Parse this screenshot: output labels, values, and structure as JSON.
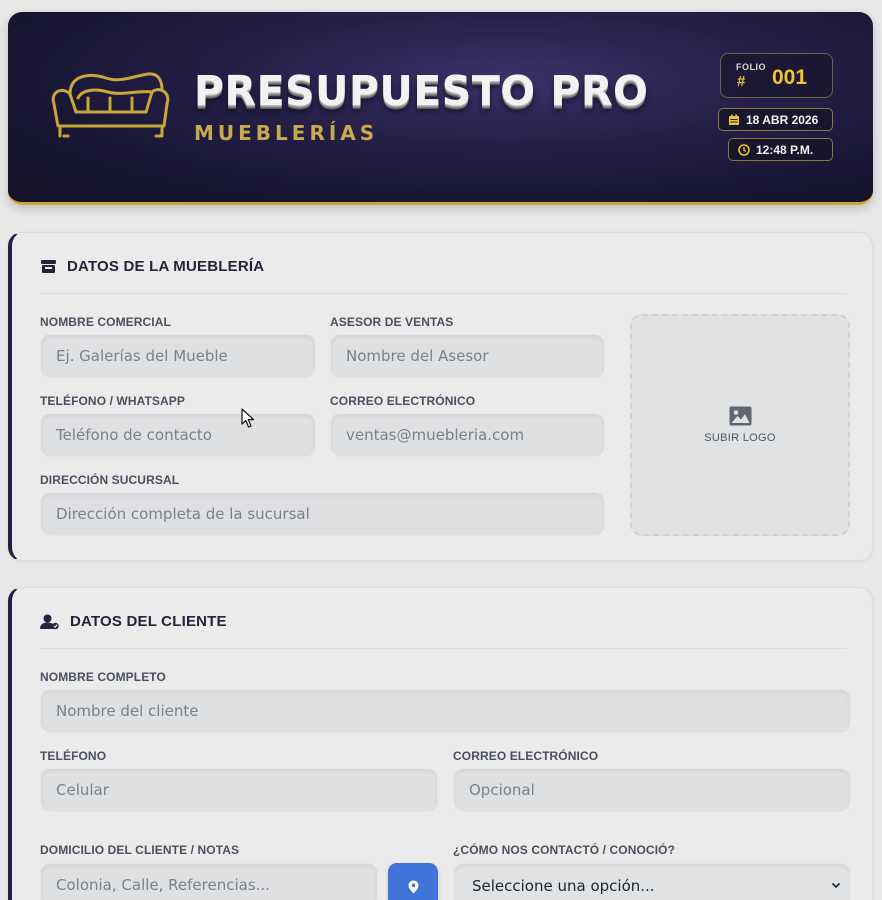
{
  "header": {
    "title": "PRESUPUESTO PRO",
    "subtitle": "MUEBLERÍAS",
    "folio_label": "FOLIO",
    "folio_hash": "#",
    "folio_number": "001",
    "date": "18 ABR 2026",
    "time": "12:48 P.M."
  },
  "store": {
    "section_title": "DATOS DE LA MUEBLERÍA",
    "trade_name_label": "NOMBRE COMERCIAL",
    "trade_name_placeholder": "Ej. Galerías del Mueble",
    "advisor_label": "ASESOR DE VENTAS",
    "advisor_placeholder": "Nombre del Asesor",
    "phone_label": "TELÉFONO / WHATSAPP",
    "phone_placeholder": "Teléfono de contacto",
    "email_label": "CORREO ELECTRÓNICO",
    "email_placeholder": "ventas@muebleria.com",
    "address_label": "DIRECCIÓN SUCURSAL",
    "address_placeholder": "Dirección completa de la sucursal",
    "upload_logo_label": "SUBIR LOGO"
  },
  "client": {
    "section_title": "DATOS DEL CLIENTE",
    "full_name_label": "NOMBRE COMPLETO",
    "full_name_placeholder": "Nombre del cliente",
    "phone_label": "TELÉFONO",
    "phone_placeholder": "Celular",
    "email_label": "CORREO ELECTRÓNICO",
    "email_placeholder": "Opcional",
    "address_label": "DOMICILIO DEL CLIENTE / NOTAS",
    "address_placeholder": "Colonia, Calle, Referencias...",
    "contact_source_label": "¿CÓMO NOS CONTACTÓ / CONOCIÓ?",
    "contact_source_selected": "Seleccione una opción..."
  },
  "colors": {
    "header_bg": "#1c1937",
    "accent_gold": "#c8aa4e",
    "folio_yellow": "#f1c52c",
    "map_button_blue": "#3f73d8",
    "card_border_navy": "#22223f"
  },
  "icons": {
    "header_logo": "sofa-icon",
    "date": "calendar-icon",
    "time": "clock-icon",
    "store_section": "store-icon",
    "client_section": "user-icon",
    "upload": "image-icon",
    "map": "map-pin-icon",
    "select": "chevron-down-icon",
    "pointer": "mouse-cursor-icon"
  }
}
